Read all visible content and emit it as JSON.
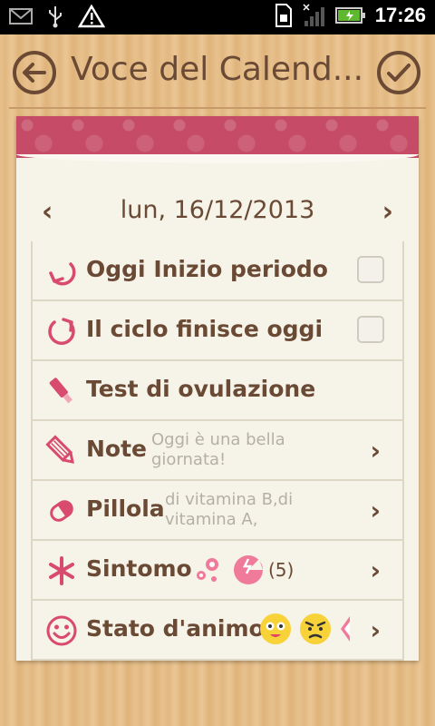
{
  "status_bar": {
    "time": "17:26"
  },
  "header": {
    "title": "Voce del Calend..."
  },
  "date": {
    "text": "lun, 16/12/2013",
    "prev": "‹",
    "next": "›"
  },
  "rows": [
    {
      "label": "Oggi Inizio periodo",
      "control": "checkbox",
      "checked": false
    },
    {
      "label": "Il ciclo finisce oggi",
      "control": "checkbox",
      "checked": false
    },
    {
      "label": "Test di ovulazione"
    },
    {
      "label": "Note",
      "sub": "Oggi è una bella giornata!",
      "sub_lines": [
        "Oggi è una bella",
        "giornata!"
      ]
    },
    {
      "label": "Pillola",
      "sub": "di vitamina B,di vitamina A,",
      "sub_lines": [
        "di vitamina B,di",
        "vitamina A,"
      ]
    },
    {
      "label": "Sintomo",
      "count": "(5)"
    },
    {
      "label": "Stato d'animo"
    }
  ],
  "colors": {
    "brown": "#6b4a35",
    "pink": "#d94b6e",
    "ribbon": "#c54b67"
  }
}
